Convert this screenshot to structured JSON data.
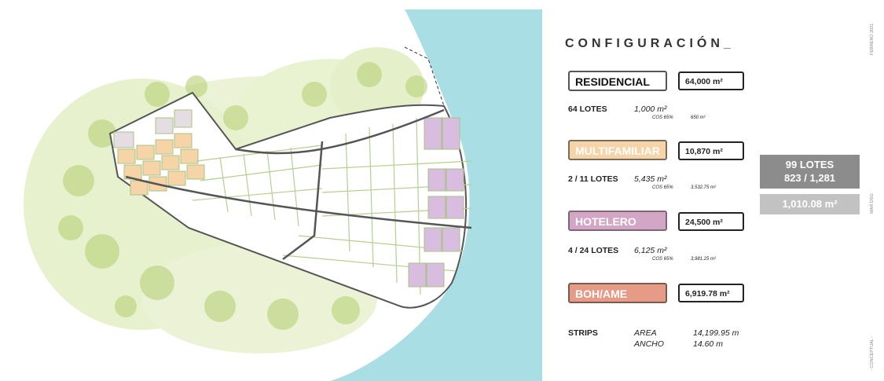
{
  "title": "CONFIGURACIÓN_",
  "categories": [
    {
      "label": "RESIDENCIAL",
      "area": "64,000 m²",
      "lotes": "64 LOTES",
      "lot_area": "1,000 m²",
      "cos": "COS 65%",
      "cos_value": "650 m²"
    },
    {
      "label": "MULTIFAMILIAR",
      "area": "10,870 m²",
      "lotes": "2 / 11 LOTES",
      "lot_area": "5,435 m²",
      "cos": "COS 65%",
      "cos_value": "3,532.75 m²"
    },
    {
      "label": "HOTELERO",
      "area": "24,500 m²",
      "lotes": "4 / 24 LOTES",
      "lot_area": "6,125 m²",
      "cos": "COS 65%",
      "cos_value": "3,981.25 m²"
    },
    {
      "label": "BOH/AME",
      "area": "6,919.78 m²"
    }
  ],
  "strips": {
    "label": "STRIPS",
    "area_label": "AREA",
    "area_value": "14,199.95 m",
    "ancho_label": "ANCHO",
    "ancho_value": "14.60 m"
  },
  "summary": {
    "line1": "99 LOTES",
    "line2": "823 / 1,281",
    "total": "1,010.08 m²"
  },
  "side_text": {
    "date": "FEBRERO 2021",
    "author": "MAR DSG",
    "phase": "- CONCEPTUAL -"
  },
  "colors": {
    "water": "#a9dee4",
    "residential": "#ffffff",
    "multifamiliar": "#f6d4a8",
    "hotelero": "#d3a6c6",
    "boh": "#e59b86",
    "vegetation": "#c4d98a"
  }
}
